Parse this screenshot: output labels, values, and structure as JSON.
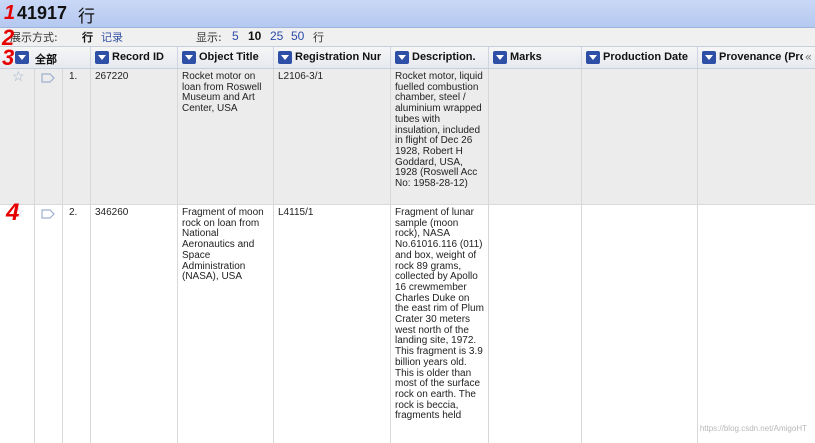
{
  "record_count": {
    "value": "41917",
    "unit": "行"
  },
  "display_mode": {
    "label": "展示方式:",
    "options": [
      "行",
      "记录"
    ],
    "selected": "行"
  },
  "page_size": {
    "label": "显示:",
    "options": [
      "5",
      "10",
      "25",
      "50"
    ],
    "selected": "10",
    "unit": "行"
  },
  "collapse_glyph": "«",
  "columns": {
    "all": "全部",
    "record_id": "Record ID",
    "object_title": "Object Title",
    "registration": "Registration Nur",
    "description": "Description.",
    "marks": "Marks",
    "production_date": "Production Date",
    "provenance": "Provenance (Pro"
  },
  "rows": [
    {
      "num": "1.",
      "record_id": "267220",
      "object_title": "Rocket motor on loan from Roswell Museum and Art Center, USA",
      "registration": "L2106-3/1",
      "description": "Rocket motor, liquid fuelled combustion chamber, steel / aluminium wrapped tubes with insulation, included in flight of Dec 26 1928, Robert H Goddard, USA, 1928 (Roswell Acc No: 1958-28-12)",
      "marks": "",
      "production_date": "",
      "provenance": ""
    },
    {
      "num": "2.",
      "record_id": "346260",
      "object_title": "Fragment of moon rock on loan from National Aeronautics and Space Administration (NASA), USA",
      "registration": "L4115/1",
      "description": "Fragment of lunar sample (moon rock), NASA No.61016.116 (011) and box, weight of rock 89 grams, collected by Apollo 16 crewmember Charles Duke on the east rim of Plum Crater 30 meters west north of the landing site, 1972. This fragment is 3.9 billion years old. This is older than most of the surface rock on earth. The rock is beccia, fragments held",
      "marks": "",
      "production_date": "",
      "provenance": ""
    }
  ],
  "annotations": [
    "1",
    "2",
    "3",
    "4"
  ],
  "watermark": "https://blog.csdn.net/AmigoHT"
}
